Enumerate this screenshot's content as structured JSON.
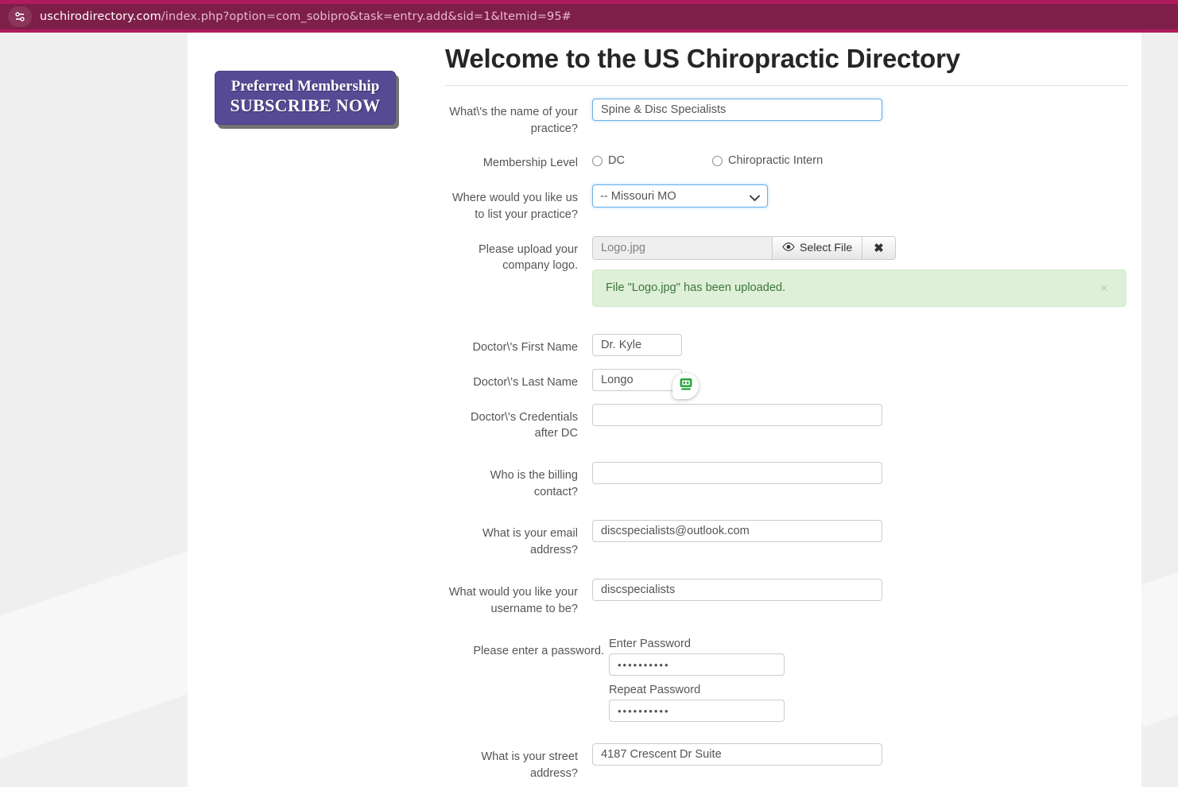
{
  "browser": {
    "icon": "site-settings-icon",
    "url_host": "uschirodirectory.com",
    "url_path": "/index.php?option=com_sobipro&task=entry.add&sid=1&Itemid=95#"
  },
  "promo": {
    "line1": "Preferred Membership",
    "line2": "SUBSCRIBE NOW"
  },
  "page": {
    "title": "Welcome to the US Chiropractic Directory"
  },
  "form": {
    "practice_name": {
      "label": "What\\'s the name of your practice?",
      "value": "Spine & Disc Specialists",
      "placeholder": ""
    },
    "membership_level": {
      "label": "Membership Level",
      "options": [
        {
          "label": "DC",
          "selected": false
        },
        {
          "label": "Chiropractic Intern",
          "selected": false
        }
      ]
    },
    "state": {
      "label": "Where would you like us to list your practice?",
      "selected": "-- Missouri MO",
      "options": [
        "-- Missouri MO"
      ]
    },
    "logo_upload": {
      "label": "Please upload your company logo.",
      "filename": "Logo.jpg",
      "select_button": "Select File",
      "remove_button": "✖",
      "alert_text": "File \"Logo.jpg\" has been uploaded.",
      "alert_close": "×"
    },
    "first_name": {
      "label": "Doctor\\'s First Name",
      "value": "Dr. Kyle"
    },
    "last_name": {
      "label": "Doctor\\'s Last Name",
      "value": "Longo"
    },
    "credentials": {
      "label": "Doctor\\'s Credentials after DC",
      "value": ""
    },
    "billing_contact": {
      "label": "Who is the billing contact?",
      "value": ""
    },
    "email": {
      "label": "What is your email address?",
      "value": "discspecialists@outlook.com"
    },
    "username": {
      "label": "What would you like your username to be?",
      "value": "discspecialists"
    },
    "password": {
      "label": "Please enter a password.",
      "enter_label": "Enter Password",
      "enter_value": "••••••••••",
      "repeat_label": "Repeat Password",
      "repeat_value": "••••••••••"
    },
    "street_address": {
      "label": "What is your street address?",
      "value": "4187 Crescent Dr Suite"
    }
  },
  "assistant": {
    "icon": "robot-icon"
  },
  "colors": {
    "urlbar_bg": "#7d1f49",
    "urlbar_accent": "#b01b5e",
    "promo_purple": "#574a95",
    "alert_green_bg": "#dff0d8",
    "alert_green_text": "#3c763d",
    "focus_blue": "#66afe9"
  }
}
